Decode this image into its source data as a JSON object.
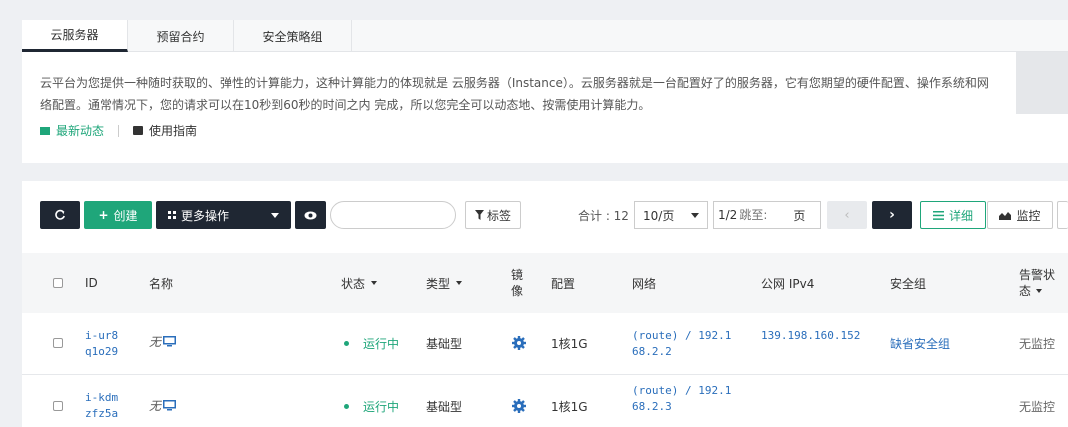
{
  "tabs": [
    "云服务器",
    "预留合约",
    "安全策略组"
  ],
  "intro": {
    "text": "云平台为您提供一种随时获取的、弹性的计算能力，这种计算能力的体现就是 云服务器（Instance）。云服务器就是一台配置好了的服务器，它有您期望的硬件配置、操作系统和网络配置。通常情况下，您的请求可以在10秒到60秒的时间之内 完成，所以您完全可以动态地、按需使用计算能力。",
    "news": "最新动态",
    "guide": "使用指南"
  },
  "toolbar": {
    "create": "创建",
    "more": "更多操作",
    "tag": "标签",
    "total": "合计 : 12",
    "page_size": "10/页",
    "page_info": "1/2",
    "jump_placeholder": "跳至:",
    "page_unit": "页",
    "detail": "详细",
    "monitor": "监控"
  },
  "columns": {
    "id": "ID",
    "name": "名称",
    "status": "状态",
    "type": "类型",
    "image_l1": "镜",
    "image_l2": "像",
    "config": "配置",
    "network": "网络",
    "ipv4": "公网 IPv4",
    "sg": "安全组",
    "alarm_l1": "告警状",
    "alarm_l2": "态"
  },
  "rows": [
    {
      "id_l1": "i-ur8",
      "id_l2": "q1o29",
      "name": "无",
      "status": "运行中",
      "type": "基础型",
      "config": "1核1G",
      "net_l1": "(route) / 192.1",
      "net_l2": "68.2.2",
      "ipv4": "139.198.160.152",
      "sg": "缺省安全组",
      "alarm": "无监控"
    },
    {
      "id_l1": "i-kdm",
      "id_l2": "zfz5a",
      "name": "无",
      "status": "运行中",
      "type": "基础型",
      "config": "1核1G",
      "net_l1": "(route) / 192.1",
      "net_l2": "68.2.3",
      "ipv4": "",
      "sg": "",
      "alarm": "无监控"
    }
  ]
}
